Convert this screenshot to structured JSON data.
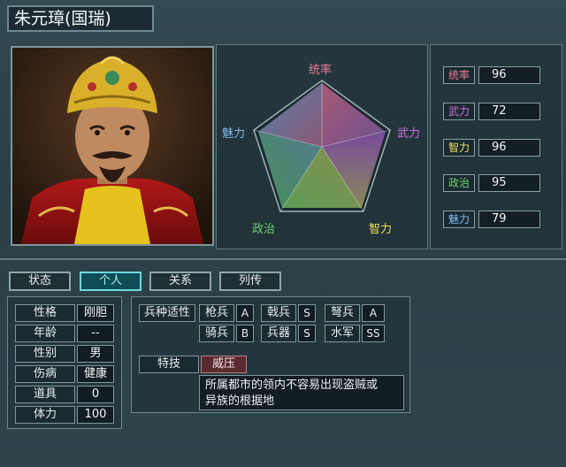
{
  "header": {
    "name": "朱元璋(国瑞)"
  },
  "radar": {
    "labels": [
      "统率",
      "武力",
      "智力",
      "政治",
      "魅力"
    ],
    "colors": [
      "#f07a9a",
      "#d070e0",
      "#f0e060",
      "#70d070",
      "#80b8f0"
    ]
  },
  "stats": [
    {
      "label": "统率",
      "value": "96",
      "color": "#f07a9a"
    },
    {
      "label": "武力",
      "value": "72",
      "color": "#d070e0"
    },
    {
      "label": "智力",
      "value": "96",
      "color": "#f0e060"
    },
    {
      "label": "政治",
      "value": "95",
      "color": "#70d070"
    },
    {
      "label": "魅力",
      "value": "79",
      "color": "#80b8f0"
    }
  ],
  "tabs": [
    "状态",
    "个人",
    "关系",
    "列传"
  ],
  "personal": [
    {
      "label": "性格",
      "value": "刚胆"
    },
    {
      "label": "年龄",
      "value": "--"
    },
    {
      "label": "性别",
      "value": "男"
    },
    {
      "label": "伤病",
      "value": "健康"
    },
    {
      "label": "道具",
      "value": "0"
    },
    {
      "label": "体力",
      "value": "100"
    }
  ],
  "aptitude": {
    "title": "兵种适性",
    "units": [
      {
        "name": "枪兵",
        "grade": "A"
      },
      {
        "name": "戟兵",
        "grade": "S"
      },
      {
        "name": "弩兵",
        "grade": "A"
      },
      {
        "name": "骑兵",
        "grade": "B"
      },
      {
        "name": "兵器",
        "grade": "S"
      },
      {
        "name": "水军",
        "grade": "SS"
      }
    ]
  },
  "skill": {
    "title": "特技",
    "name": "威压",
    "desc1": "所属都市的领内不容易出现盗贼或",
    "desc2": "异族的根据地"
  }
}
